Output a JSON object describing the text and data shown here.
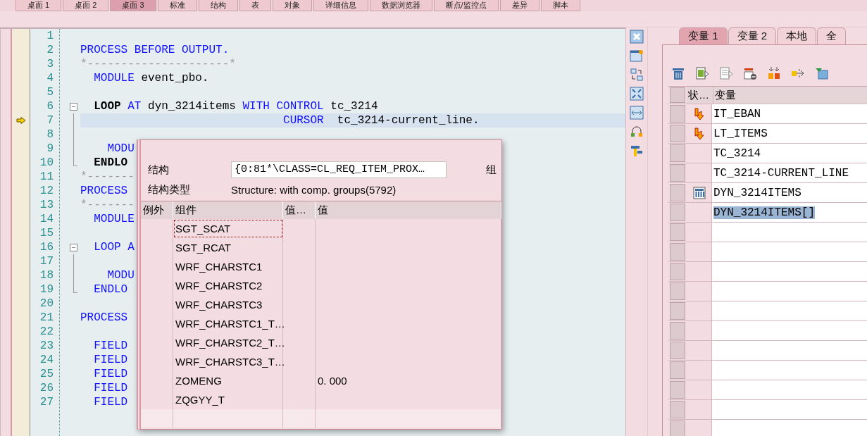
{
  "top_tabs": [
    {
      "label": "桌面 1",
      "selected": false
    },
    {
      "label": "桌面 2",
      "selected": false
    },
    {
      "label": "桌面 3",
      "selected": true
    },
    {
      "label": "标准",
      "selected": false
    },
    {
      "label": "结构",
      "selected": false
    },
    {
      "label": "表",
      "selected": false
    },
    {
      "label": "对象",
      "selected": false
    },
    {
      "label": "详细信息",
      "selected": false
    },
    {
      "label": "数据浏览器",
      "selected": false
    },
    {
      "label": "断点/监控点",
      "selected": false
    },
    {
      "label": "差异",
      "selected": false
    },
    {
      "label": "脚本",
      "selected": false
    }
  ],
  "editor": {
    "lines": [
      {
        "number": "1",
        "current": false
      },
      {
        "number": "2",
        "current": false,
        "segments": [
          {
            "kind": "keyword",
            "text": "PROCESS BEFORE OUTPUT."
          }
        ]
      },
      {
        "number": "3",
        "current": false,
        "segments": [
          {
            "kind": "comment",
            "text": "*---------------------*"
          }
        ]
      },
      {
        "number": "4",
        "current": false,
        "segments": [
          {
            "kind": "keyword",
            "text": "  MODULE"
          },
          {
            "kind": "plain",
            "text": " event_pbo."
          }
        ]
      },
      {
        "number": "5",
        "current": false
      },
      {
        "number": "6",
        "current": false,
        "kind": "fold_start",
        "segments": [
          {
            "kind": "strong",
            "text": "  LOOP"
          },
          {
            "kind": "keyword",
            "text": " AT"
          },
          {
            "kind": "plain",
            "text": " dyn_3214items"
          },
          {
            "kind": "keyword",
            "text": " WITH CONTROL"
          },
          {
            "kind": "plain",
            "text": " tc_3214"
          }
        ]
      },
      {
        "number": "7",
        "current": true,
        "kind": "fold_body",
        "segments": [
          {
            "kind": "keyword",
            "text": "                              CURSOR"
          },
          {
            "kind": "plain",
            "text": "  tc_3214-current_line."
          }
        ]
      },
      {
        "number": "8",
        "current": false,
        "kind": "fold_body"
      },
      {
        "number": "9",
        "current": false,
        "kind": "fold_body",
        "segments": [
          {
            "kind": "keyword",
            "text": "    MODU"
          }
        ]
      },
      {
        "number": "10",
        "current": false,
        "kind": "fold_end",
        "segments": [
          {
            "kind": "strong",
            "text": "  ENDLO"
          }
        ]
      },
      {
        "number": "11",
        "current": false,
        "segments": [
          {
            "kind": "comment",
            "text": "*-------"
          }
        ]
      },
      {
        "number": "12",
        "current": false,
        "segments": [
          {
            "kind": "keyword",
            "text": "PROCESS"
          }
        ]
      },
      {
        "number": "13",
        "current": false,
        "segments": [
          {
            "kind": "comment",
            "text": "*-------"
          }
        ]
      },
      {
        "number": "14",
        "current": false,
        "segments": [
          {
            "kind": "keyword",
            "text": "  MODULE"
          }
        ]
      },
      {
        "number": "15",
        "current": false
      },
      {
        "number": "16",
        "current": false,
        "kind": "fold_start",
        "segments": [
          {
            "kind": "keyword",
            "text": "  LOOP A"
          }
        ]
      },
      {
        "number": "17",
        "current": false,
        "kind": "fold_body"
      },
      {
        "number": "18",
        "current": false,
        "kind": "fold_body",
        "segments": [
          {
            "kind": "keyword",
            "text": "    MODU"
          }
        ]
      },
      {
        "number": "19",
        "current": false,
        "kind": "fold_end",
        "segments": [
          {
            "kind": "keyword",
            "text": "  ENDLO"
          }
        ]
      },
      {
        "number": "20",
        "current": false
      },
      {
        "number": "21",
        "current": false,
        "segments": [
          {
            "kind": "keyword",
            "text": "PROCESS"
          }
        ]
      },
      {
        "number": "22",
        "current": false
      },
      {
        "number": "23",
        "current": false,
        "segments": [
          {
            "kind": "keyword",
            "text": "  FIELD"
          }
        ]
      },
      {
        "number": "24",
        "current": false,
        "segments": [
          {
            "kind": "keyword",
            "text": "  FIELD"
          }
        ]
      },
      {
        "number": "25",
        "current": false,
        "segments": [
          {
            "kind": "keyword",
            "text": "  FIELD"
          }
        ]
      },
      {
        "number": "26",
        "current": false,
        "segments": [
          {
            "kind": "keyword",
            "text": "  FIELD"
          }
        ]
      },
      {
        "number": "27",
        "current": false,
        "segments": [
          {
            "kind": "keyword",
            "text": "  FIELD"
          }
        ]
      }
    ]
  },
  "popup": {
    "fields": [
      {
        "kind": "input",
        "label": "结构",
        "value": "{0:81*\\CLASS=CL_REQ_ITEM_PROX…"
      },
      {
        "kind": "text",
        "label": "结构类型",
        "value": "Structure: with comp. groups(5792)"
      }
    ],
    "side_label": "组",
    "columns": [
      "例外",
      "组件",
      "值…",
      "值"
    ],
    "rows": [
      {
        "component": "SGT_SCAT",
        "focused": true
      },
      {
        "component": "SGT_RCAT",
        "focused": false
      },
      {
        "component": "WRF_CHARSTC1",
        "focused": false
      },
      {
        "component": "WRF_CHARSTC2",
        "focused": false
      },
      {
        "component": "WRF_CHARSTC3",
        "focused": false
      },
      {
        "component": "WRF_CHARSTC1_T…",
        "focused": false
      },
      {
        "component": "WRF_CHARSTC2_T…",
        "focused": false
      },
      {
        "component": "WRF_CHARSTC3_T…",
        "focused": false
      },
      {
        "component": "ZOMENG",
        "value": "0. 000",
        "focused": false
      },
      {
        "component": "ZQGYY_T",
        "focused": false
      }
    ]
  },
  "variables": {
    "tabs": [
      {
        "label": "变量 1",
        "selected": true
      },
      {
        "label": "变量 2",
        "selected": false
      },
      {
        "label": "本地",
        "selected": false
      },
      {
        "label": "全",
        "selected": false
      }
    ],
    "columns": [
      "状…",
      "变量"
    ],
    "rows": [
      {
        "kind": "reference",
        "name": "IT_EBAN",
        "selected": false
      },
      {
        "kind": "reference",
        "name": "LT_ITEMS",
        "selected": false
      },
      {
        "name": "TC_3214",
        "selected": false
      },
      {
        "name": "TC_3214-CURRENT_LINE",
        "selected": false
      },
      {
        "kind": "table",
        "name": "DYN_3214ITEMS",
        "selected": false
      },
      {
        "name": "DYN_3214ITEMS[]",
        "selected": true
      }
    ]
  }
}
